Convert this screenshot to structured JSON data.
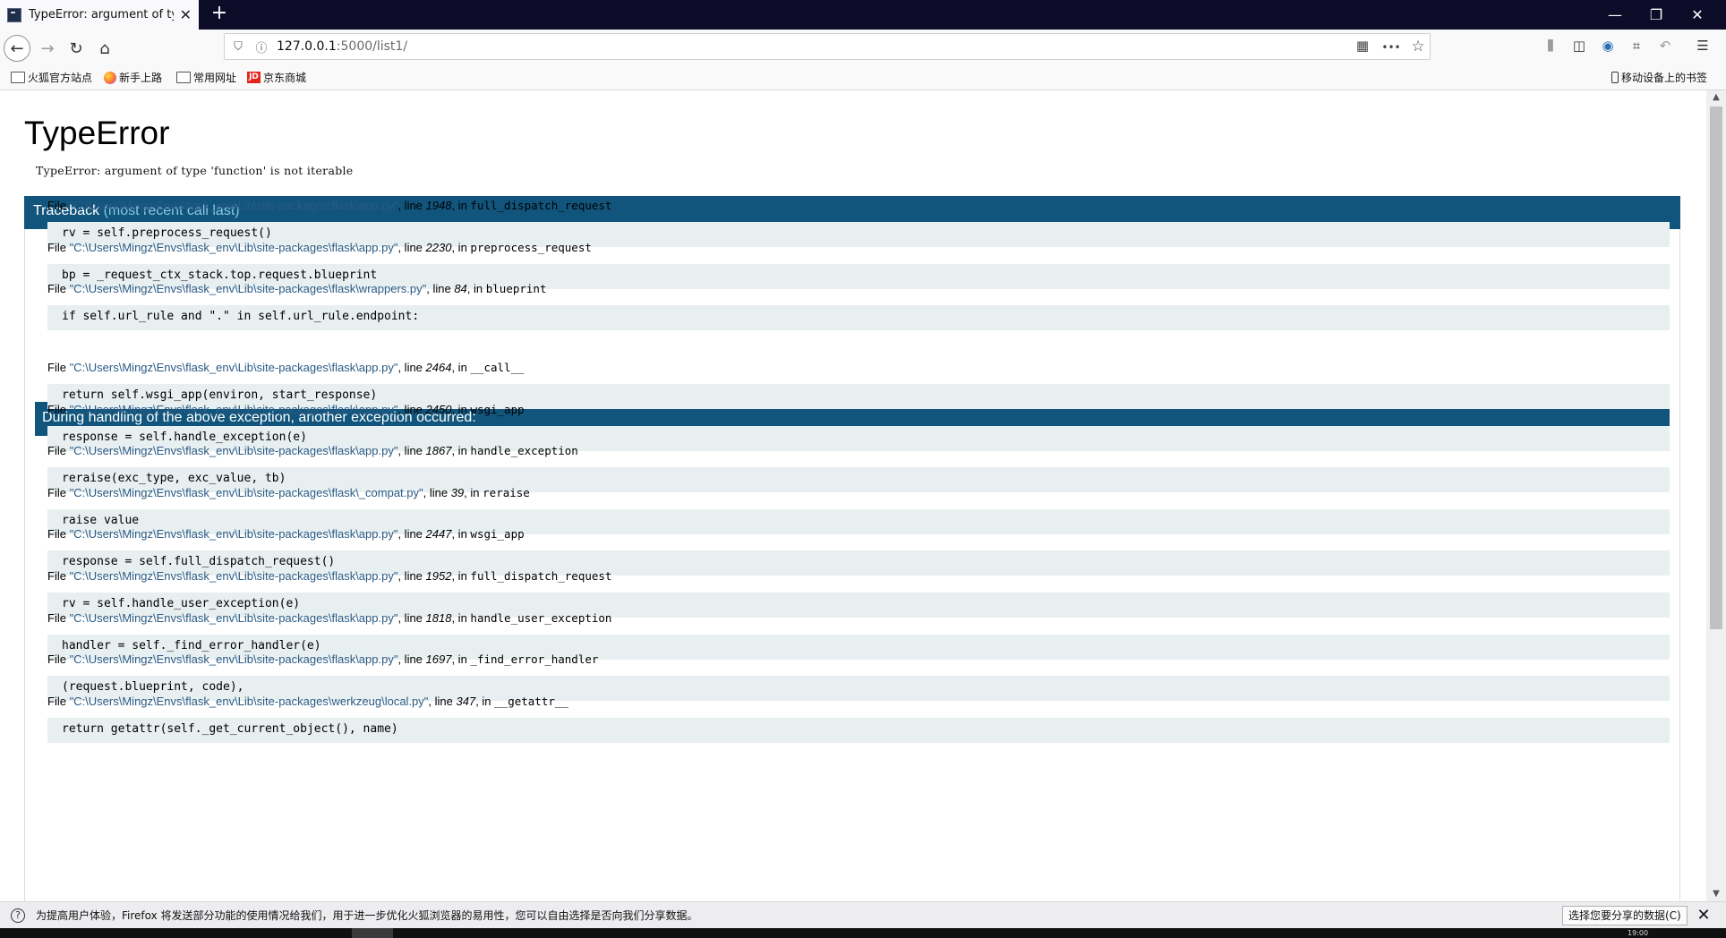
{
  "browser": {
    "tab_title": "TypeError: argument of type 'function' is not iterable",
    "tab_close": "✕",
    "new_tab": "+",
    "window_controls": [
      "—",
      "❐",
      "✕"
    ],
    "url_host": "127.0.0.1",
    "url_rest": ":5000/list1/",
    "bookmarks": [
      "火狐官方站点",
      "新手上路",
      "常用网址",
      "京东商城"
    ],
    "mobile_bookmarks": "移动设备上的书签",
    "jd_logo_text": "JD",
    "icons": {
      "back": "←",
      "forward": "→",
      "reload": "↻",
      "home": "⌂",
      "shield": "⛉",
      "info": "ⓘ",
      "qr": "▦",
      "more": "•••",
      "star": "☆",
      "library": "⫼",
      "sidebar": "◫",
      "account": "◉",
      "crop": "⌗",
      "undo": "↶",
      "menu": "☰"
    }
  },
  "page": {
    "title": "TypeError",
    "message": "TypeError: argument of type 'function' is not iterable",
    "traceback_label": "Traceback",
    "traceback_sub": "(most recent call last)",
    "mid_header": "During handling of the above exception, another exception occurred:",
    "frames_first": [
      {
        "file": "\"C:\\Users\\Mingz\\Envs\\flask_env\\Lib\\site-packages\\flask\\app.py\"",
        "line": "1948",
        "func": "full_dispatch_request",
        "code": "rv = self.preprocess_request()"
      },
      {
        "file": "\"C:\\Users\\Mingz\\Envs\\flask_env\\Lib\\site-packages\\flask\\app.py\"",
        "line": "2230",
        "func": "preprocess_request",
        "code": "bp = _request_ctx_stack.top.request.blueprint"
      },
      {
        "file": "\"C:\\Users\\Mingz\\Envs\\flask_env\\Lib\\site-packages\\flask\\wrappers.py\"",
        "line": "84",
        "func": "blueprint",
        "code": "if self.url_rule and \".\" in self.url_rule.endpoint:"
      }
    ],
    "frames_second": [
      {
        "file": "\"C:\\Users\\Mingz\\Envs\\flask_env\\Lib\\site-packages\\flask\\app.py\"",
        "line": "2464",
        "func": "__call__",
        "code": "return self.wsgi_app(environ, start_response)"
      },
      {
        "file": "\"C:\\Users\\Mingz\\Envs\\flask_env\\Lib\\site-packages\\flask\\app.py\"",
        "line": "2450",
        "func": "wsgi_app",
        "code": "response = self.handle_exception(e)"
      },
      {
        "file": "\"C:\\Users\\Mingz\\Envs\\flask_env\\Lib\\site-packages\\flask\\app.py\"",
        "line": "1867",
        "func": "handle_exception",
        "code": "reraise(exc_type, exc_value, tb)"
      },
      {
        "file": "\"C:\\Users\\Mingz\\Envs\\flask_env\\Lib\\site-packages\\flask\\_compat.py\"",
        "line": "39",
        "func": "reraise",
        "code": "raise value"
      },
      {
        "file": "\"C:\\Users\\Mingz\\Envs\\flask_env\\Lib\\site-packages\\flask\\app.py\"",
        "line": "2447",
        "func": "wsgi_app",
        "code": "response = self.full_dispatch_request()"
      },
      {
        "file": "\"C:\\Users\\Mingz\\Envs\\flask_env\\Lib\\site-packages\\flask\\app.py\"",
        "line": "1952",
        "func": "full_dispatch_request",
        "code": "rv = self.handle_user_exception(e)"
      },
      {
        "file": "\"C:\\Users\\Mingz\\Envs\\flask_env\\Lib\\site-packages\\flask\\app.py\"",
        "line": "1818",
        "func": "handle_user_exception",
        "code": "handler = self._find_error_handler(e)"
      },
      {
        "file": "\"C:\\Users\\Mingz\\Envs\\flask_env\\Lib\\site-packages\\flask\\app.py\"",
        "line": "1697",
        "func": "_find_error_handler",
        "code": "(request.blueprint, code),"
      },
      {
        "file": "\"C:\\Users\\Mingz\\Envs\\flask_env\\Lib\\site-packages\\werkzeug\\local.py\"",
        "line": "347",
        "func": "__getattr__",
        "code": "return getattr(self._get_current_object(), name)"
      }
    ],
    "file_prefix": "File ",
    "line_prefix": ", line ",
    "in_prefix": ", in "
  },
  "notification": {
    "icon": "?",
    "text": "为提高用户体验，Firefox 将发送部分功能的使用情况给我们，用于进一步优化火狐浏览器的易用性，您可以自由选择是否向我们分享数据。",
    "button": "选择您要分享的数据(C)",
    "close": "✕"
  },
  "taskbar": {
    "clock": "19:00"
  }
}
